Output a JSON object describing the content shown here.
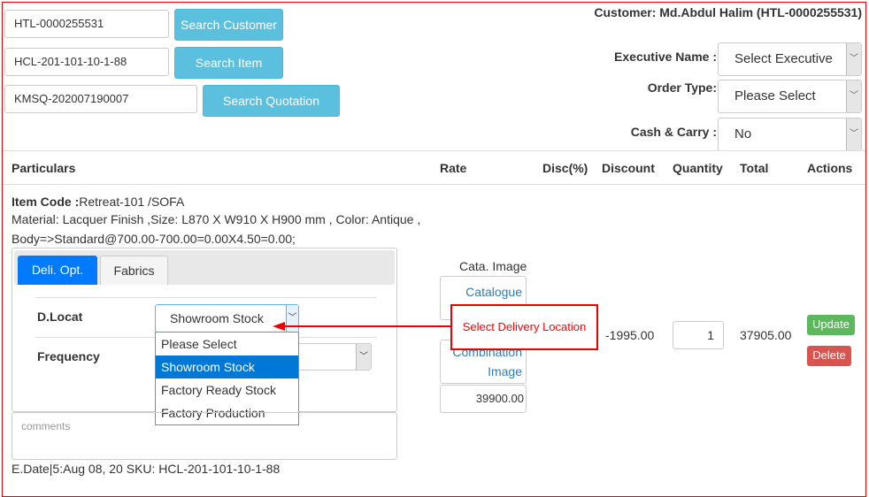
{
  "search": {
    "customer_value": "HTL-0000255531",
    "customer_button": "Search Customer",
    "item_value": "HCL-201-101-10-1-88",
    "item_button": "Search Item",
    "quotation_value": "KMSQ-202007190007",
    "quotation_button": "Search Quotation"
  },
  "customer_label": "Customer: Md.Abdul Halim (HTL-0000255531)",
  "form": {
    "executive_label": "Executive Name :",
    "executive_value": "Select Executive",
    "order_type_label": "Order Type:",
    "order_type_value": "Please Select",
    "cash_carry_label": "Cash & Carry :",
    "cash_carry_value": "No"
  },
  "table": {
    "headers": [
      "Particulars",
      "Rate",
      "Disc(%)",
      "Discount",
      "Quantity",
      "Total",
      "Actions"
    ]
  },
  "item": {
    "code_label": "Item Code :",
    "code_value": "Retreat-101 /SOFA",
    "material": "Material: Lacquer Finish ,Size: L870 X W910 X H900 mm , Color: Antique ,",
    "body": "Body=>Standard@700.00-700.00=0.00X4.50=0.00;",
    "tabs": [
      "Deli. Opt.",
      "Fabrics"
    ],
    "dlocat_label": "D.Locat",
    "dlocat_value": "Showroom Stock",
    "frequency_label": "Frequency",
    "dlocat_options": [
      "Please Select",
      "Showroom Stock",
      "Factory Ready Stock",
      "Factory Production"
    ],
    "comments_placeholder": "comments",
    "footer": "E.Date|5:Aug 08, 20 SKU: HCL-201-101-10-1-88",
    "cata_image_label": "Cata. Image",
    "catalogue_link": "Catalogue Image",
    "combination_link": "Combination Image",
    "rate_value": "39900.00",
    "discount": "-1995.00",
    "quantity": "1",
    "total": "37905.00",
    "update": "Update",
    "delete": "Delete"
  },
  "callout": {
    "text": "Select Delivery Location",
    "color": "#ff0000"
  },
  "colors": {
    "info": "#5bc0de",
    "primary": "#007bff",
    "success": "#5cb85c",
    "danger": "#d9534f"
  }
}
